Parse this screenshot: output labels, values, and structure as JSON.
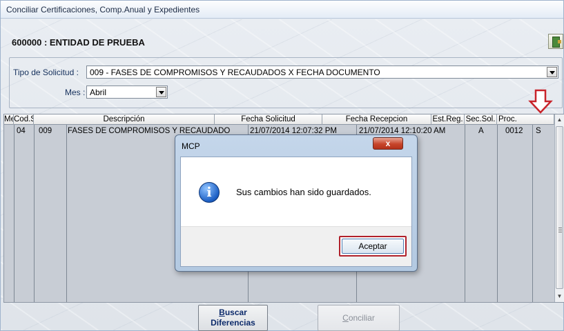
{
  "window": {
    "title": "Conciliar  Certificaciones, Comp.Anual y Expedientes"
  },
  "entity": {
    "title": "600000 : ENTIDAD DE PRUEBA"
  },
  "filters": {
    "tipo_label": "Tipo de Solicitud :",
    "tipo_value": "009 - FASES DE COMPROMISOS Y RECAUDADOS X FECHA DOCUMENTO",
    "mes_label": "Mes :",
    "mes_value": "Abril"
  },
  "grid": {
    "columns": [
      "Mes",
      "Cod.Sol.",
      "Descripción",
      "Fecha Solicitud",
      "Fecha Recepcion",
      "Est.Reg.",
      "Sec.Sol.",
      "Proc."
    ],
    "row": {
      "mes": "04",
      "cod": "009",
      "desc": "FASES DE COMPROMISOS Y RECAUDADO",
      "fsol": "21/07/2014 12:07:32 PM",
      "frec": "21/07/2014 12:10:20 AM",
      "est": "A",
      "sec": "0012",
      "proc": "S"
    }
  },
  "buttons": {
    "buscar_u": "B",
    "buscar_rest": "uscar",
    "buscar_l2": "Diferencias",
    "conciliar_u": "C",
    "conciliar_rest": "onciliar"
  },
  "dialog": {
    "title": "MCP",
    "close_glyph": "x",
    "icon_glyph": "i",
    "message": "Sus cambios han sido guardados.",
    "ok_label": "Aceptar"
  },
  "colors": {
    "highlight_red": "#b0202a"
  }
}
